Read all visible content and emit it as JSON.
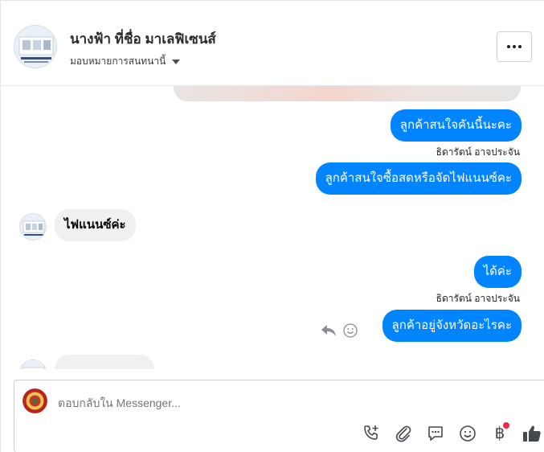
{
  "header": {
    "title": "นางฟ้า ที่ชื่อ มาเลฟิเซนส์",
    "assign_label": "มอบหมายการสนทนานี้"
  },
  "messages": [
    {
      "direction": "outgoing",
      "text": "ลูกค้าสนใจคันนี้นะคะ"
    },
    {
      "direction": "outgoing",
      "sender": "ธิดารัตน์ อาจประจัน",
      "text": "ลูกค้าสนใจซื้อสดหรือจัดไฟแนนซ์คะ"
    },
    {
      "direction": "incoming",
      "text": "ไฟแนนซ์ค่ะ"
    },
    {
      "direction": "outgoing",
      "text": "ได้ค่ะ"
    },
    {
      "direction": "outgoing",
      "sender": "ธิดารัตน์ อาจประจัน",
      "text": "ลูกค้าอยู่จังหวัดอะไรคะ"
    }
  ],
  "composer": {
    "placeholder": "ตอบกลับใน Messenger...",
    "baht_symbol": "฿"
  },
  "icons": [
    "more-options-icon",
    "caret-down-icon",
    "reply-icon",
    "emoji-react-icon",
    "add-call-icon",
    "attachment-icon",
    "saved-reply-icon",
    "emoji-icon",
    "payment-icon",
    "like-icon"
  ],
  "colors": {
    "outgoing_bubble": "#0084ff",
    "incoming_bubble": "#f0f0f0",
    "notification_dot": "#f02849"
  }
}
